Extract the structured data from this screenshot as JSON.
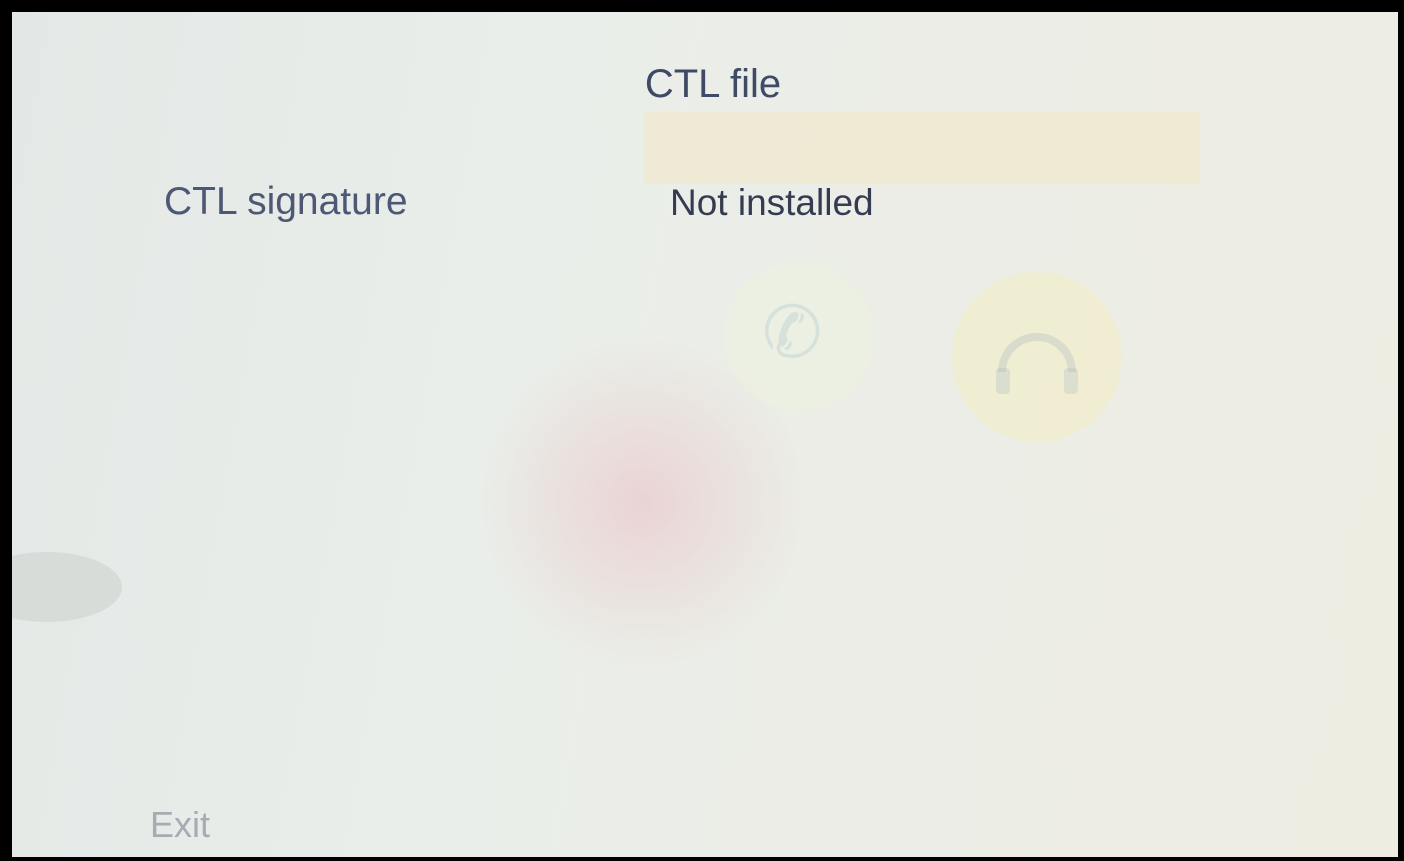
{
  "screen": {
    "title": "CTL file",
    "rows": [
      {
        "label": "CTL signature",
        "value": "Not installed"
      }
    ],
    "softkeys": {
      "exit_label": "Exit"
    }
  },
  "background_ghost": {
    "icons": [
      "phone-icon",
      "headset-icon"
    ]
  },
  "colors": {
    "title": "#3f4a66",
    "label": "#4d5876",
    "value": "#353c52",
    "softkey": "#a6adb2",
    "background": "#e8ece8"
  }
}
